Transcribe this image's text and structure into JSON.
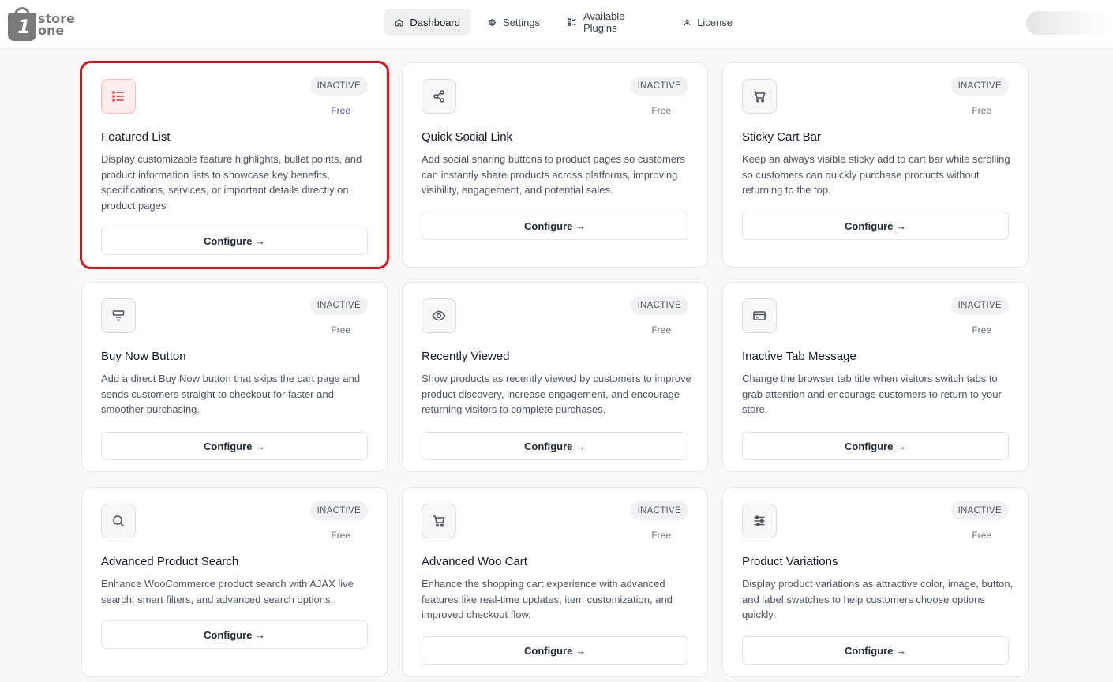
{
  "brand": {
    "logo_text_1": "store",
    "logo_text_2": "one",
    "logo_mark": "1"
  },
  "nav": {
    "dashboard": "Dashboard",
    "settings": "Settings",
    "plugins": "Available Plugins",
    "license": "License"
  },
  "cards": [
    {
      "icon": "list-icon",
      "status": "INACTIVE",
      "price": "Free",
      "title": "Featured List",
      "description": "Display customizable feature highlights, bullet points, and product information lists to showcase key benefits, specifications, services, or important details directly on product pages",
      "button": "Configure →"
    },
    {
      "icon": "share-icon",
      "status": "INACTIVE",
      "price": "Free",
      "title": "Quick Social Link",
      "description": "Add social sharing buttons to product pages so customers can instantly share products across platforms, improving visibility, engagement, and potential sales.",
      "button": "Configure →"
    },
    {
      "icon": "cart-icon",
      "status": "INACTIVE",
      "price": "Free",
      "title": "Sticky Cart Bar",
      "description": "Keep an always visible sticky add to cart bar while scrolling so customers can quickly purchase products without returning to the top.",
      "button": "Configure →"
    },
    {
      "icon": "button-icon",
      "status": "INACTIVE",
      "price": "Free",
      "title": "Buy Now Button",
      "description": "Add a direct Buy Now button that skips the cart page and sends customers straight to checkout for faster and smoother purchasing.",
      "button": "Configure →"
    },
    {
      "icon": "eye-icon",
      "status": "INACTIVE",
      "price": "Free",
      "title": "Recently Viewed",
      "description": "Show products as recently viewed by customers to improve product discovery, increase engagement, and encourage returning visitors to complete purchases.",
      "button": "Configure →"
    },
    {
      "icon": "card-icon",
      "status": "INACTIVE",
      "price": "Free",
      "title": "Inactive Tab Message",
      "description": "Change the browser tab title when visitors switch tabs to grab attention and encourage customers to return to your store.",
      "button": "Configure →"
    },
    {
      "icon": "search-icon",
      "status": "INACTIVE",
      "price": "Free",
      "title": "Advanced Product Search",
      "description": "Enhance WooCommerce product search with AJAX live search, smart filters, and advanced search options.",
      "button": "Configure →"
    },
    {
      "icon": "cart-icon",
      "status": "INACTIVE",
      "price": "Free",
      "title": "Advanced Woo Cart",
      "description": "Enhance the shopping cart experience with advanced features like real-time updates, item customization, and improved checkout flow.",
      "button": "Configure →"
    },
    {
      "icon": "sliders-icon",
      "status": "INACTIVE",
      "price": "Free",
      "title": "Product Variations",
      "description": "Display product variations as attractive color, image, button, and label swatches to help customers choose options quickly.",
      "button": "Configure →"
    }
  ]
}
